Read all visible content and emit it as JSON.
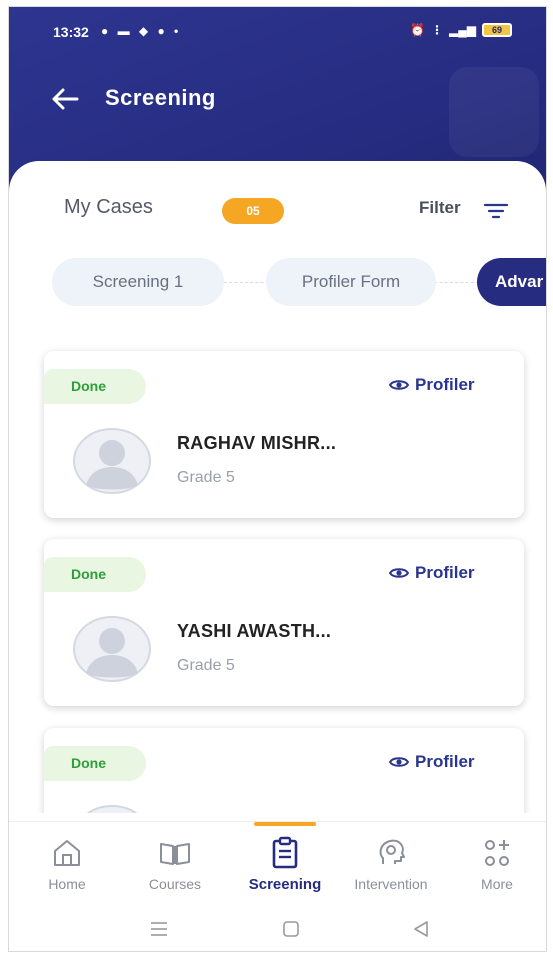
{
  "status_bar": {
    "time": "13:32",
    "left_icons": [
      "notification-icon",
      "message-icon",
      "chat-icon",
      "jio-icon",
      "dot-icon"
    ],
    "right_icons": [
      "alarm-icon",
      "volte-icon",
      "signal-icon"
    ],
    "battery": "69"
  },
  "app_bar": {
    "title": "Screening",
    "back_icon": "arrow-left-icon"
  },
  "cases": {
    "label": "My Cases",
    "count": "05",
    "filter_label": "Filter",
    "filter_icon": "filter-lines-icon"
  },
  "steps": [
    {
      "label": "Screening 1",
      "active": false
    },
    {
      "label": "Profiler Form",
      "active": false
    },
    {
      "label": "Advar",
      "active": true
    }
  ],
  "students": [
    {
      "status": "Done",
      "action": "Profiler",
      "name": "RAGHAV MISHR...",
      "grade": "Grade 5"
    },
    {
      "status": "Done",
      "action": "Profiler",
      "name": "YASHI AWASTH...",
      "grade": "Grade 5"
    },
    {
      "status": "Done",
      "action": "Profiler",
      "name": "",
      "grade": ""
    }
  ],
  "bottom_nav": [
    {
      "label": "Home",
      "icon": "home-icon",
      "active": false
    },
    {
      "label": "Courses",
      "icon": "book-icon",
      "active": false
    },
    {
      "label": "Screening",
      "icon": "clipboard-icon",
      "active": true
    },
    {
      "label": "Intervention",
      "icon": "head-gear-icon",
      "active": false
    },
    {
      "label": "More",
      "icon": "grid-plus-icon",
      "active": false
    }
  ],
  "colors": {
    "header": "#262c80",
    "accent": "#f5a623",
    "done_bg": "#e9f7e2",
    "done_text": "#2e9e3a",
    "link": "#2a3590"
  }
}
